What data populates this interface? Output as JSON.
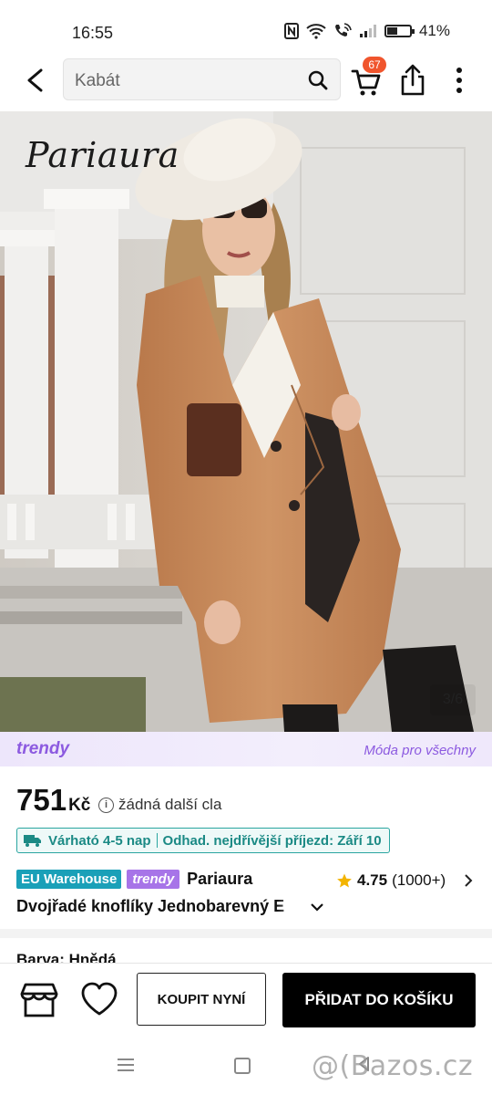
{
  "status_bar": {
    "time": "16:55",
    "battery": "41%",
    "battery_level": 0.41
  },
  "header": {
    "search_text": "Kabát",
    "cart_count": "67",
    "icons": [
      "back-arrow-icon",
      "search-icon",
      "cart-icon",
      "share-icon",
      "more-vert-icon"
    ]
  },
  "gallery": {
    "brand_overlay": "Pariaura",
    "counter": "3/6"
  },
  "banner": {
    "logo": "trendy",
    "tagline": "Móda pro všechny"
  },
  "product": {
    "price": "751",
    "currency": "Kč",
    "duty_note": "žádná další cla",
    "delivery_estimate": "Várható 4-5 nap",
    "arrival": "Odhad. nejdřívější příjezd: Září 10",
    "tag_warehouse": "EU Warehouse",
    "tag_trendy": "trendy",
    "store_name": "Pariaura",
    "rating": "4.75",
    "rating_count": "(1000+)",
    "title": "Dvojřadé knoflíky Jednobarevný E",
    "color_label": "Barva: Hnědá"
  },
  "actions": {
    "buy_now": "KOUPIT NYNÍ",
    "add_to_cart": "PŘIDAT DO KOŠÍKU"
  },
  "watermark": "@(Bazos.cz",
  "colors": {
    "accent_purple": "#8c5ae0",
    "teal": "#1aa0b8",
    "badge_orange": "#f0552d",
    "coat_camel": "#c98a5c"
  }
}
